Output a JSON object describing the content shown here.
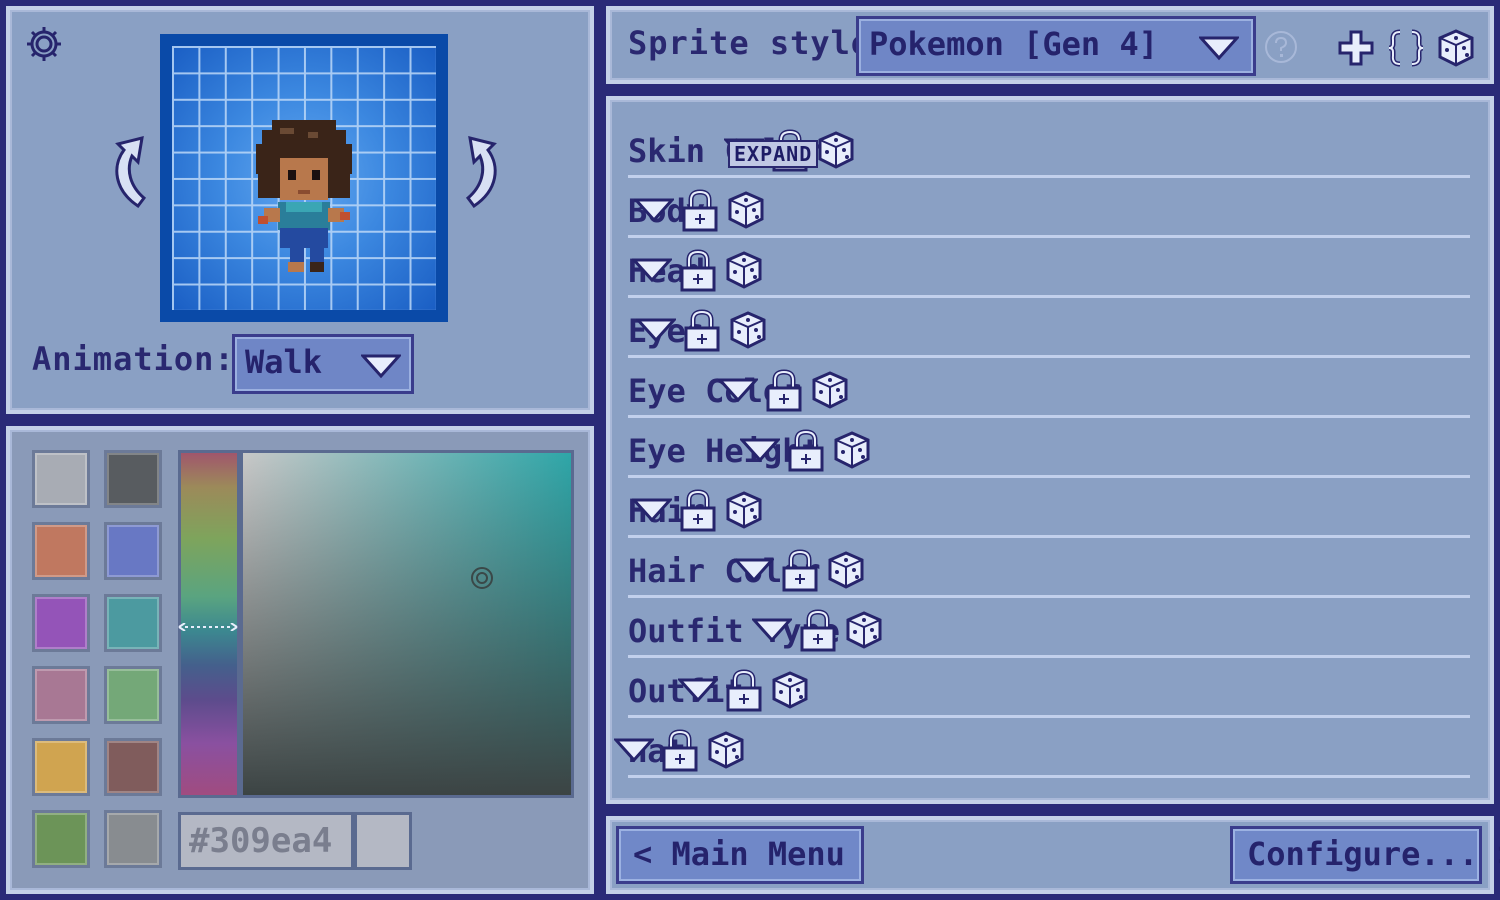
{
  "preview": {
    "animation_label": "Animation:",
    "animation_value": "Walk"
  },
  "palette": {
    "swatches": [
      "#a8acb4",
      "#585c60",
      "#c07860",
      "#6878c4",
      "#9454b8",
      "#4c9aa0",
      "#a87894",
      "#74a878",
      "#d0a450",
      "#805c5c",
      "#6c9458",
      "#888c90"
    ],
    "hex_value": "#309ea4"
  },
  "style": {
    "label": "Sprite style:",
    "value": "Pokemon [Gen 4]"
  },
  "options": {
    "rows": [
      {
        "label": "Skin Color"
      },
      {
        "label": "Body"
      },
      {
        "label": "Head"
      },
      {
        "label": "Eyes"
      },
      {
        "label": "Eye Color"
      },
      {
        "label": "Eye Height"
      },
      {
        "label": "Hair"
      },
      {
        "label": "Hair Color"
      },
      {
        "label": "Outfit Type"
      },
      {
        "label": "Outfit"
      },
      {
        "label": "Hat"
      }
    ],
    "tooltip": "EXPAND"
  },
  "nav": {
    "main_menu": "< Main Menu",
    "configure": "Configure... >"
  }
}
